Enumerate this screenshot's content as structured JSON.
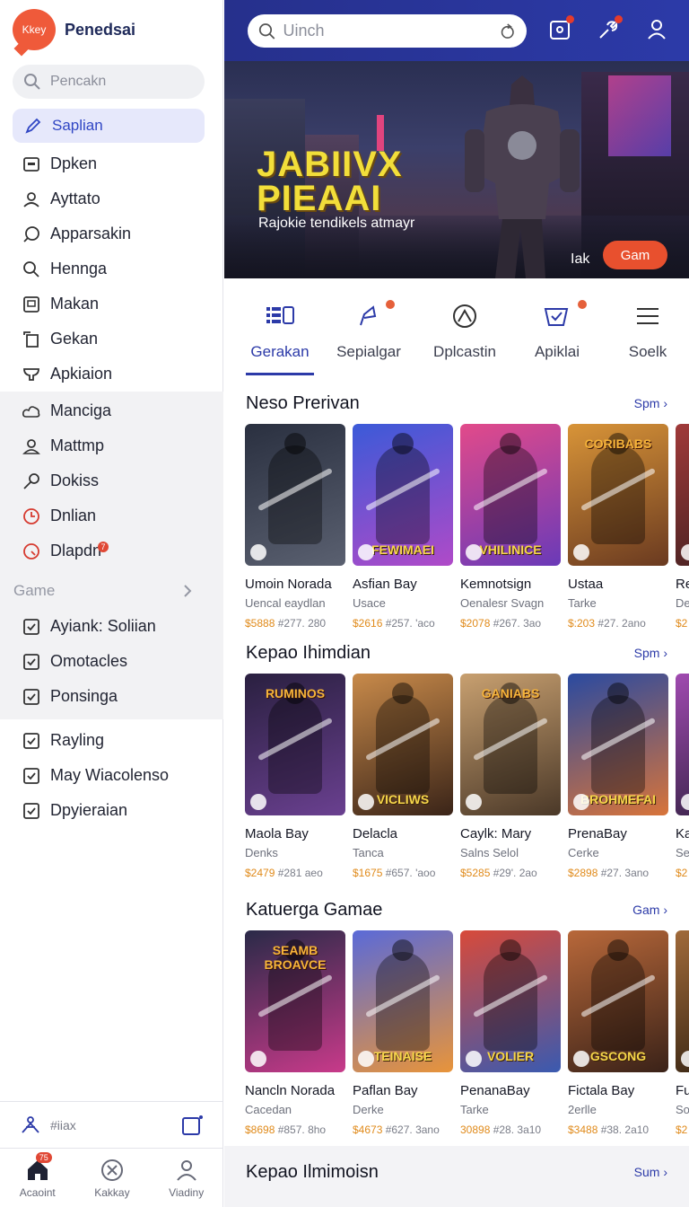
{
  "brand": {
    "logo_text": "Kkey",
    "name": "Penedsai"
  },
  "sidebar": {
    "search_placeholder": "Pencakn",
    "active_item": "Saplian",
    "items": [
      {
        "label": "Dpken",
        "icon": "window-icon"
      },
      {
        "label": "Ayttato",
        "icon": "users-icon"
      },
      {
        "label": "Apparsakin",
        "icon": "chat-icon"
      },
      {
        "label": "Hennga",
        "icon": "search-icon"
      },
      {
        "label": "Makan",
        "icon": "image-icon"
      },
      {
        "label": "Gekan",
        "icon": "copy-icon"
      },
      {
        "label": "Apkiaion",
        "icon": "cup-icon"
      }
    ],
    "band_items": [
      {
        "label": "Manciga",
        "icon": "cloud-icon"
      },
      {
        "label": "Mattmp",
        "icon": "user-icon"
      },
      {
        "label": "Dokiss",
        "icon": "key-icon"
      },
      {
        "label": "Dnlian",
        "icon": "clock-icon"
      },
      {
        "label": "Dlapdn",
        "icon": "gauge-icon",
        "badge": "7"
      }
    ],
    "section_label": "Game",
    "section_items": [
      {
        "label": "Ayiank: Soliian"
      },
      {
        "label": "Omotacles"
      },
      {
        "label": "Ponsinga"
      }
    ],
    "extra_items": [
      {
        "label": "Rayling"
      },
      {
        "label": "May Wiacolenso"
      },
      {
        "label": "Dpyieraian"
      }
    ],
    "footer_label": "#iiax",
    "bottom_nav": [
      {
        "label": "Acaoint",
        "badge": "75"
      },
      {
        "label": "Kakkay"
      },
      {
        "label": "Viadiny"
      }
    ]
  },
  "topbar": {
    "search_placeholder": "Uinch"
  },
  "hero": {
    "title_line1": "JABIIVX",
    "title_line2": "PIEAAI",
    "subtitle": "Rajokie tendikels atmayr",
    "tag": "Iak",
    "button": "Gam"
  },
  "tabs": [
    {
      "label": "Gerakan"
    },
    {
      "label": "Sepialgar"
    },
    {
      "label": "Dplcastin"
    },
    {
      "label": "Apiklai"
    },
    {
      "label": "Soelk"
    }
  ],
  "sections": [
    {
      "title": "Neso Prerivan",
      "more": "Spm ›",
      "cards": [
        {
          "name": "Umoin Norada",
          "sub": "Uencal eaydlan",
          "price_accent": "$5888",
          "price_rest": " #277. 280",
          "top": "",
          "caption": "",
          "colors": [
            "#2a3040",
            "#5a6070"
          ]
        },
        {
          "name": "Asfian Bay",
          "sub": "Usace",
          "price_accent": "$2616",
          "price_rest": " #257. 'aco",
          "top": "",
          "caption": "FEWIMAEI",
          "colors": [
            "#3b5ad8",
            "#b04ac8"
          ]
        },
        {
          "name": "Kemnotsign",
          "sub": "Oenalesr Svagn",
          "price_accent": "$2078",
          "price_rest": " #267. 3ao",
          "top": "",
          "caption": "VHILINICE",
          "colors": [
            "#e24a8a",
            "#6a3ab8"
          ]
        },
        {
          "name": "Ustaa",
          "sub": "Tarke",
          "price_accent": "$:203",
          "price_rest": " #27. 2ano",
          "top": "CORIBABS",
          "caption": "",
          "colors": [
            "#d89438",
            "#6a3a20"
          ]
        },
        {
          "name": "Re",
          "sub": "De",
          "price_accent": "$2",
          "price_rest": "",
          "top": "",
          "caption": "",
          "colors": [
            "#a03a3a",
            "#402020"
          ]
        }
      ]
    },
    {
      "title": "Kepao Ihimdian",
      "more": "Spm ›",
      "cards": [
        {
          "name": "Maola Bay",
          "sub": "Denks",
          "price_accent": "$2479",
          "price_rest": " #281 aeo",
          "top": "RUMINOS",
          "caption": "",
          "colors": [
            "#2a2040",
            "#6a4090"
          ]
        },
        {
          "name": "Delacla",
          "sub": "Tanca",
          "price_accent": "$1675",
          "price_rest": " #657. 'aoo",
          "top": "",
          "caption": "VICLIWS",
          "colors": [
            "#c88a4a",
            "#3a2418"
          ]
        },
        {
          "name": "Caylk: Mary",
          "sub": "Salns Selol",
          "price_accent": "$5285",
          "price_rest": " #29'. 2ao",
          "top": "GANIABS",
          "caption": "",
          "colors": [
            "#c8a070",
            "#4a3828"
          ]
        },
        {
          "name": "PrenaBay",
          "sub": "Cerke",
          "price_accent": "$2898",
          "price_rest": " #27. 3ano",
          "top": "",
          "caption": "BROHMEFAI",
          "colors": [
            "#2a4aa0",
            "#d8743a"
          ]
        },
        {
          "name": "Ka",
          "sub": "Se",
          "price_accent": "$2",
          "price_rest": "",
          "top": "",
          "caption": "",
          "colors": [
            "#a04ab0",
            "#302040"
          ]
        }
      ]
    },
    {
      "title": "Katuerga Gamae",
      "more": "Gam ›",
      "cards": [
        {
          "name": "Nancln Norada",
          "sub": "Cacedan",
          "price_accent": "$8698",
          "price_rest": " #857. 8ho",
          "top": "SEAMB BROAVCE",
          "caption": "",
          "colors": [
            "#2a2a48",
            "#c83a8a"
          ]
        },
        {
          "name": "Paflan Bay",
          "sub": "Derke",
          "price_accent": "$4673",
          "price_rest": " #627. 3ano",
          "top": "",
          "caption": "TEINAISE",
          "colors": [
            "#5a6ad8",
            "#e8943a"
          ]
        },
        {
          "name": "PenanaBay",
          "sub": "Tarke",
          "price_accent": "30898",
          "price_rest": " #28. 3a10",
          "top": "",
          "caption": "VOLIER",
          "colors": [
            "#d84a3a",
            "#3a5ab0"
          ]
        },
        {
          "name": "Fictala Bay",
          "sub": "2erlle",
          "price_accent": "$3488",
          "price_rest": " #38. 2a10",
          "top": "",
          "caption": "GSCONG",
          "colors": [
            "#b8683a",
            "#3a2218"
          ]
        },
        {
          "name": "Fu",
          "sub": "So",
          "price_accent": "$2",
          "price_rest": "",
          "top": "",
          "caption": "",
          "colors": [
            "#a06a3a",
            "#302010"
          ]
        }
      ]
    }
  ],
  "last_section": {
    "title": "Kepao Ilmimoisn",
    "more": "Sum ›"
  }
}
